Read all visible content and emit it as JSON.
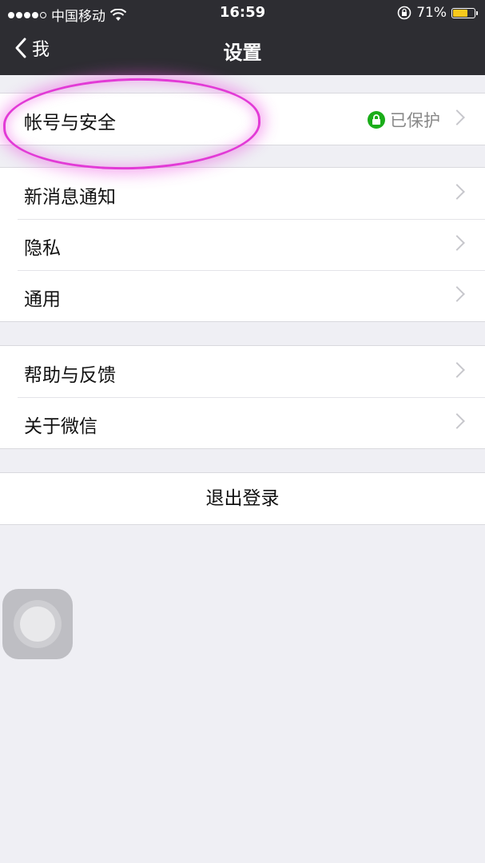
{
  "status_bar": {
    "carrier": "中国移动",
    "time": "16:59",
    "battery_percent": "71%",
    "battery_level": 0.71,
    "battery_color": "#f7c81c"
  },
  "nav": {
    "back_label": "我",
    "title": "设置"
  },
  "groups": [
    {
      "items": [
        {
          "label": "帐号与安全",
          "detail": "已保护",
          "detail_icon": "lock-icon"
        }
      ]
    },
    {
      "items": [
        {
          "label": "新消息通知"
        },
        {
          "label": "隐私"
        },
        {
          "label": "通用"
        }
      ]
    },
    {
      "items": [
        {
          "label": "帮助与反馈"
        },
        {
          "label": "关于微信"
        }
      ]
    }
  ],
  "logout_label": "退出登录",
  "colors": {
    "nav_background": "#2d2d32",
    "page_background": "#efeff4",
    "protect_green": "#1aad19",
    "highlight_pink": "#e23ad6"
  }
}
